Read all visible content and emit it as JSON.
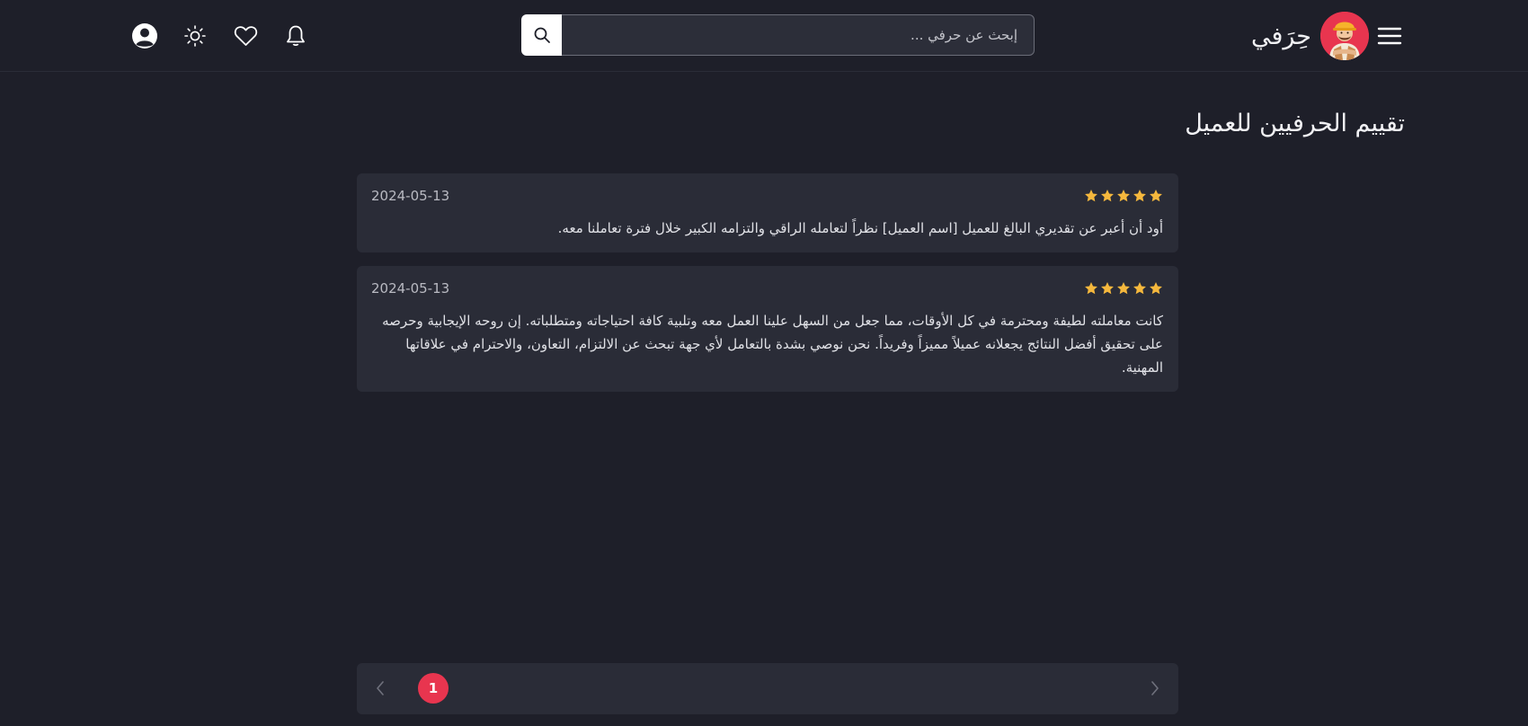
{
  "header": {
    "brand_name": "حِرَفي",
    "search_placeholder": "إبحث عن حرفي ...",
    "icons": [
      "menu-icon",
      "logo",
      "search-icon",
      "bell-icon",
      "heart-icon",
      "sun-icon",
      "user-icon"
    ]
  },
  "main": {
    "title": "تقييم الحرفيين للعميل",
    "reviews": [
      {
        "rating": 5,
        "date": "2024-05-13",
        "text": "أود أن أعبر عن تقديري البالغ للعميل [اسم العميل] نظراً لتعامله الراقي والتزامه الكبير خلال فترة تعاملنا معه."
      },
      {
        "rating": 5,
        "date": "2024-05-13",
        "text": "كانت معاملته لطيفة ومحترمة في كل الأوقات، مما جعل من السهل علينا العمل معه وتلبية كافة احتياجاته ومتطلباته. إن روحه الإيجابية وحرصه على تحقيق أفضل النتائج يجعلانه عميلاً مميزاً وفريداً. نحن نوصي بشدة بالتعامل لأي جهة تبحث عن الالتزام، التعاون، والاحترام في علاقاتها المهنية."
      }
    ]
  },
  "pagination": {
    "current_page": "1"
  },
  "colors": {
    "background": "#1e1f29",
    "card": "#2a2c37",
    "accent": "#e8354f",
    "star": "#f5b83d"
  }
}
